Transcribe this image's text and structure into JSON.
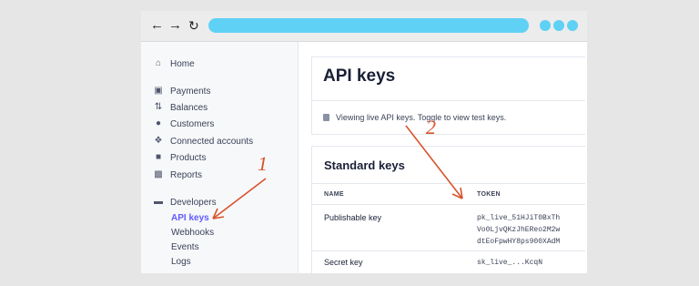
{
  "browser": {
    "nav_icons": [
      "back-arrow-icon",
      "forward-arrow-icon",
      "reload-icon"
    ],
    "url_bar_color": "#5fd1f5",
    "menu_dots": 3
  },
  "sidebar": {
    "items": [
      {
        "label": "Home",
        "icon": "home-icon"
      },
      {
        "label": "Payments",
        "icon": "payments-icon"
      },
      {
        "label": "Balances",
        "icon": "balances-icon"
      },
      {
        "label": "Customers",
        "icon": "customers-icon"
      },
      {
        "label": "Connected accounts",
        "icon": "connected-accounts-icon"
      },
      {
        "label": "Products",
        "icon": "products-icon"
      },
      {
        "label": "Reports",
        "icon": "reports-icon"
      },
      {
        "label": "Developers",
        "icon": "developers-icon"
      }
    ],
    "developer_subitems": [
      "API keys",
      "Webhooks",
      "Events",
      "Logs"
    ],
    "active_subitem": "API keys",
    "active_color": "#635bff"
  },
  "main": {
    "title": "API keys",
    "notice": "Viewing live API keys. Toggle to view test keys.",
    "standard_keys": {
      "heading": "Standard keys",
      "columns": [
        "NAME",
        "TOKEN"
      ],
      "rows": [
        {
          "name": "Publishable key",
          "token_lines": [
            "pk_live_51HJiT0BxTh",
            "Vo0LjvQKzJhEReo2M2w",
            "dtEoFpwHY8ps900XAdM"
          ]
        },
        {
          "name": "Secret key",
          "token_lines": [
            "sk_live_...KcqN"
          ]
        }
      ]
    }
  },
  "annotations": {
    "labels": [
      "1",
      "2"
    ],
    "color": "#d9532c"
  }
}
